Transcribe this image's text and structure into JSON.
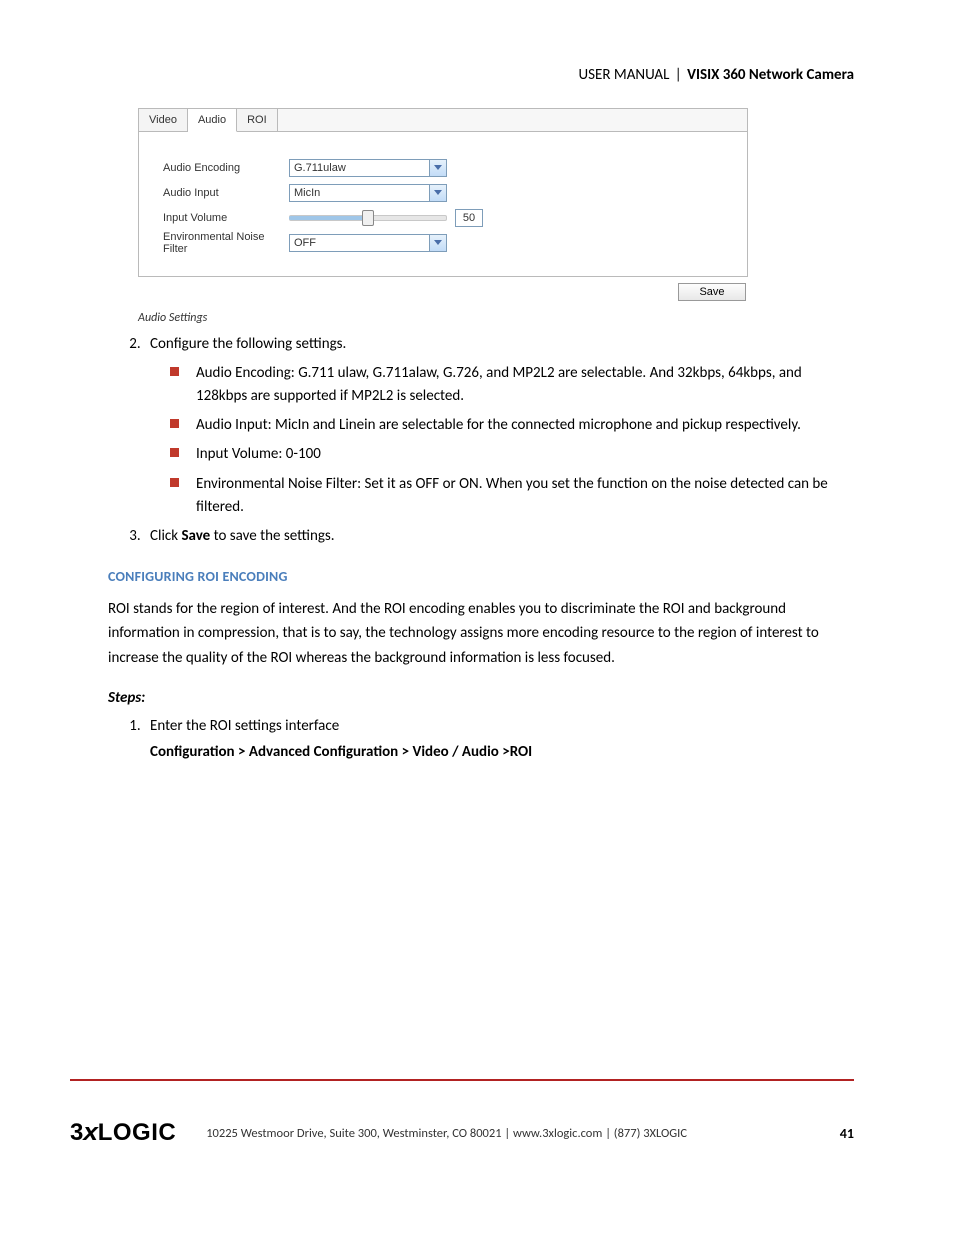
{
  "header": {
    "left": "USER MANUAL",
    "product": "VISIX 360 Network Camera"
  },
  "panel": {
    "tabs": [
      "Video",
      "Audio",
      "ROI"
    ],
    "activeTab": 1,
    "rows": {
      "audioEncoding": {
        "label": "Audio Encoding",
        "value": "G.711ulaw"
      },
      "audioInput": {
        "label": "Audio Input",
        "value": "MicIn"
      },
      "inputVolume": {
        "label": "Input Volume",
        "value": "50"
      },
      "envNoise": {
        "label": "Environmental Noise Filter",
        "value": "OFF"
      }
    },
    "saveLabel": "Save"
  },
  "caption": "Audio Settings",
  "list": {
    "item2": "Configure the following settings.",
    "b1": "Audio Encoding: G.711 ulaw, G.711alaw, G.726, and MP2L2 are selectable. And 32kbps, 64kbps, and 128kbps are supported if MP2L2 is selected.",
    "b2": "Audio Input: MicIn and Linein are selectable for the connected microphone and pickup respectively.",
    "b3": "Input Volume: 0-100",
    "b4": "Environmental Noise Filter: Set it as OFF or ON. When you set the function on the noise detected can be filtered.",
    "item3_a": "Click ",
    "item3_b": "Save",
    "item3_c": " to save the settings."
  },
  "section": {
    "title": "CONFIGURING ROI ENCODING",
    "para": "ROI stands for the region of interest. And the ROI encoding enables you to discriminate the ROI and background information in compression, that is to say, the technology assigns more encoding resource to the region of interest to increase the quality of the ROI whereas the background information is less focused."
  },
  "stepsLabel": "Steps:",
  "steps": {
    "s1": "Enter the ROI settings interface",
    "s1path": "Configuration > Advanced Configuration > Video / Audio >ROI"
  },
  "footer": {
    "logo": "3xLOGIC",
    "text": "10225 Westmoor Drive, Suite 300, Westminster, CO 80021 | www.3xlogic.com | (877) 3XLOGIC",
    "page": "41"
  }
}
